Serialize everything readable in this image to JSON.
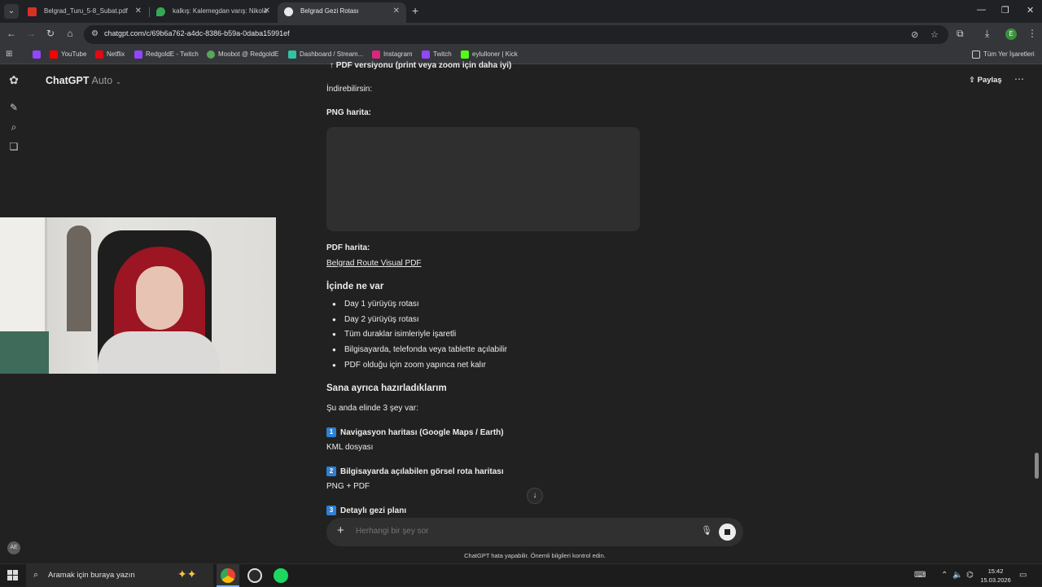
{
  "browser": {
    "tabs": [
      {
        "title": "Belgrad_Turu_5-8_Subat.pdf",
        "icon": "pdf-icon",
        "active": false
      },
      {
        "title": "kalkış: Kalemegdan varış: Nikola",
        "icon": "maps-pin-icon",
        "active": false
      },
      {
        "title": "Belgrad Gezi Rotası",
        "icon": "chatgpt-icon",
        "active": true
      }
    ],
    "url": "chatgpt.com/c/69b6a762-a4dc-8386-b59a-0daba15991ef",
    "bookmarks": [
      {
        "label": "",
        "icon": "twitch-icon",
        "color": "#9146ff"
      },
      {
        "label": "YouTube",
        "icon": "youtube-icon",
        "color": "#ff0000"
      },
      {
        "label": "Netflix",
        "icon": "netflix-icon",
        "color": "#e50914"
      },
      {
        "label": "RedgoldE - Twitch",
        "icon": "twitch-icon",
        "color": "#9146ff"
      },
      {
        "label": "Moobot @ RedgoldE",
        "icon": "moobot-icon",
        "color": "#5aa65a"
      },
      {
        "label": "Dashboard / Stream...",
        "icon": "streamlabs-icon",
        "color": "#31c3a2"
      },
      {
        "label": "Instagram",
        "icon": "instagram-icon",
        "color": "#d6287a"
      },
      {
        "label": "Twitch",
        "icon": "twitch-icon",
        "color": "#9146ff"
      },
      {
        "label": "eylulloner | Kick",
        "icon": "kick-icon",
        "color": "#53fc18"
      }
    ],
    "all_bookmarks": "Tüm Yer İşaretleri"
  },
  "header": {
    "model": "ChatGPT",
    "mode": "Auto",
    "share": "Paylaş"
  },
  "message": {
    "top_cut": "PDF versiyonu (print veya zoom için daha iyi)",
    "downloadable": "İndirebilirsin:",
    "png_label": "PNG harita:",
    "pdf_label": "PDF harita:",
    "pdf_link": "Belgrad Route Visual PDF",
    "contents_heading": "İçinde ne var",
    "contents_items": [
      "Day 1 yürüyüş rotası",
      "Day 2 yürüyüş rotası",
      "Tüm duraklar isimleriyle işaretli",
      "Bilgisayarda, telefonda veya tablette açılabilir",
      "PDF olduğu için zoom yapınca net kalır"
    ],
    "prepared_heading": "Sana ayrıca hazırladıklarım",
    "prepared_intro": "Şu anda elinde 3 şey var:",
    "prepared_items": [
      {
        "num": "1",
        "title": "Navigasyon haritası (Google Maps / Earth)",
        "sub": "KML dosyası"
      },
      {
        "num": "2",
        "title": "Bilgisayarda açılabilen görsel rota haritası",
        "sub": "PNG + PDF"
      },
      {
        "num": "3",
        "title": "Detaylı gezi planı",
        "sub": ""
      }
    ]
  },
  "composer": {
    "placeholder": "Herhangi bir şey sor",
    "disclaimer": "ChatGPT hata yapabilir. Önemli bilgileri kontrol edin."
  },
  "taskbar": {
    "search_placeholder": "Aramak için buraya yazın",
    "time": "15:42",
    "date": "15.03.2026"
  }
}
